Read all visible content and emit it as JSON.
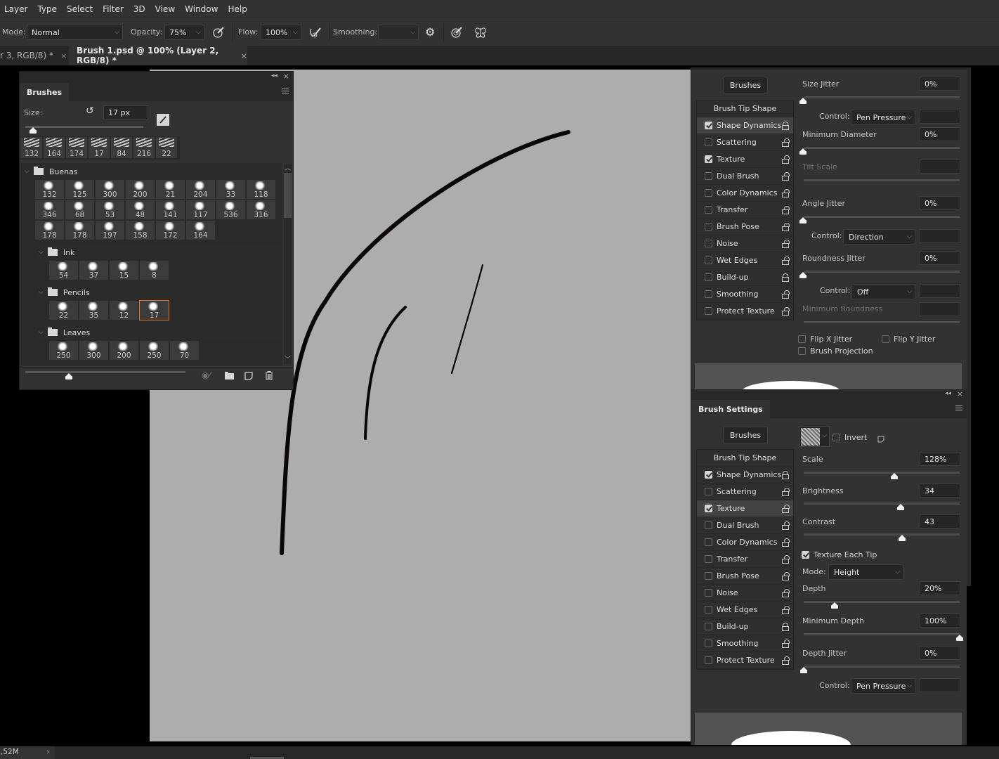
{
  "menu": [
    "Layer",
    "Type",
    "Select",
    "Filter",
    "3D",
    "View",
    "Window",
    "Help"
  ],
  "options": {
    "mode_label": "Mode:",
    "mode_value": "Normal",
    "opacity_label": "Opacity:",
    "opacity_value": "75%",
    "flow_label": "Flow:",
    "flow_value": "100%",
    "smoothing_label": "Smoothing:",
    "smoothing_value": ""
  },
  "tabs": [
    {
      "label": "r 3, RGB/8) *",
      "active": false
    },
    {
      "label": "Brush 1.psd @ 100% (Layer 2, RGB/8) *",
      "active": true
    }
  ],
  "close_glyph": "×",
  "brushes_panel": {
    "title": "Brushes",
    "size_label": "Size:",
    "size_value": "17 px",
    "size_slider_fraction": 0.02,
    "recent": [
      "132",
      "164",
      "174",
      "17",
      "84",
      "216",
      "22"
    ],
    "groups": [
      {
        "name": "Buenas",
        "items": [
          "132",
          "125",
          "300",
          "200",
          "21",
          "204",
          "33",
          "118",
          "346",
          "68",
          "53",
          "48",
          "141",
          "117",
          "536",
          "316",
          "178",
          "178",
          "197",
          "158",
          "172",
          "164"
        ]
      },
      {
        "name": "Ink",
        "items": [
          "54",
          "37",
          "15",
          "8"
        ]
      },
      {
        "name": "Pencils",
        "items": [
          "22",
          "35",
          "12",
          "17"
        ],
        "selected_index": 3
      },
      {
        "name": "Leaves",
        "items": [
          "250",
          "300",
          "200",
          "250",
          "70"
        ]
      }
    ],
    "preview_size_fraction": 0.27
  },
  "shape_dynamics_panel": {
    "brushes_button": "Brushes",
    "size_jitter_label": "Size Jitter",
    "size_jitter_value": "0%",
    "control_label": "Control:",
    "size_control": "Pen Pressure",
    "min_diameter_label": "Minimum Diameter",
    "min_diameter_value": "0%",
    "tilt_scale_label": "Tilt Scale",
    "angle_jitter_label": "Angle Jitter",
    "angle_jitter_value": "0%",
    "angle_control": "Direction",
    "roundness_jitter_label": "Roundness Jitter",
    "roundness_jitter_value": "0%",
    "roundness_control": "Off",
    "min_roundness_label": "Minimum Roundness",
    "flip_x_label": "Flip X Jitter",
    "flip_y_label": "Flip Y Jitter",
    "brush_projection_label": "Brush Projection"
  },
  "option_list": [
    {
      "label": "Brush Tip Shape",
      "tip": true
    },
    {
      "label": "Shape Dynamics",
      "checked": true,
      "locked": true
    },
    {
      "label": "Scattering",
      "checked": false
    },
    {
      "label": "Texture",
      "checked": true
    },
    {
      "label": "Dual Brush",
      "checked": false
    },
    {
      "label": "Color Dynamics",
      "checked": false
    },
    {
      "label": "Transfer",
      "checked": false
    },
    {
      "label": "Brush Pose",
      "checked": false
    },
    {
      "label": "Noise",
      "checked": false
    },
    {
      "label": "Wet Edges",
      "checked": false
    },
    {
      "label": "Build-up",
      "checked": false,
      "locked": true
    },
    {
      "label": "Smoothing",
      "checked": false
    },
    {
      "label": "Protect Texture",
      "checked": false
    }
  ],
  "brush_settings_panel": {
    "title": "Brush Settings",
    "brushes_button": "Brushes",
    "invert_label": "Invert",
    "scale_label": "Scale",
    "scale_value": "128%",
    "scale_fraction": 0.58,
    "brightness_label": "Brightness",
    "brightness_value": "34",
    "brightness_fraction": 0.62,
    "contrast_label": "Contrast",
    "contrast_value": "43",
    "contrast_fraction": 0.63,
    "texture_each_tip_label": "Texture Each Tip",
    "mode_label": "Mode:",
    "mode_value": "Height",
    "depth_label": "Depth",
    "depth_value": "20%",
    "depth_fraction": 0.2,
    "min_depth_label": "Minimum Depth",
    "min_depth_value": "100%",
    "min_depth_fraction": 1.0,
    "depth_jitter_label": "Depth Jitter",
    "depth_jitter_value": "0%",
    "depth_jitter_fraction": 0,
    "control_label": "Control:",
    "depth_control": "Pen Pressure"
  },
  "status": {
    "doc_size": ",52M",
    "arrow": "›"
  }
}
